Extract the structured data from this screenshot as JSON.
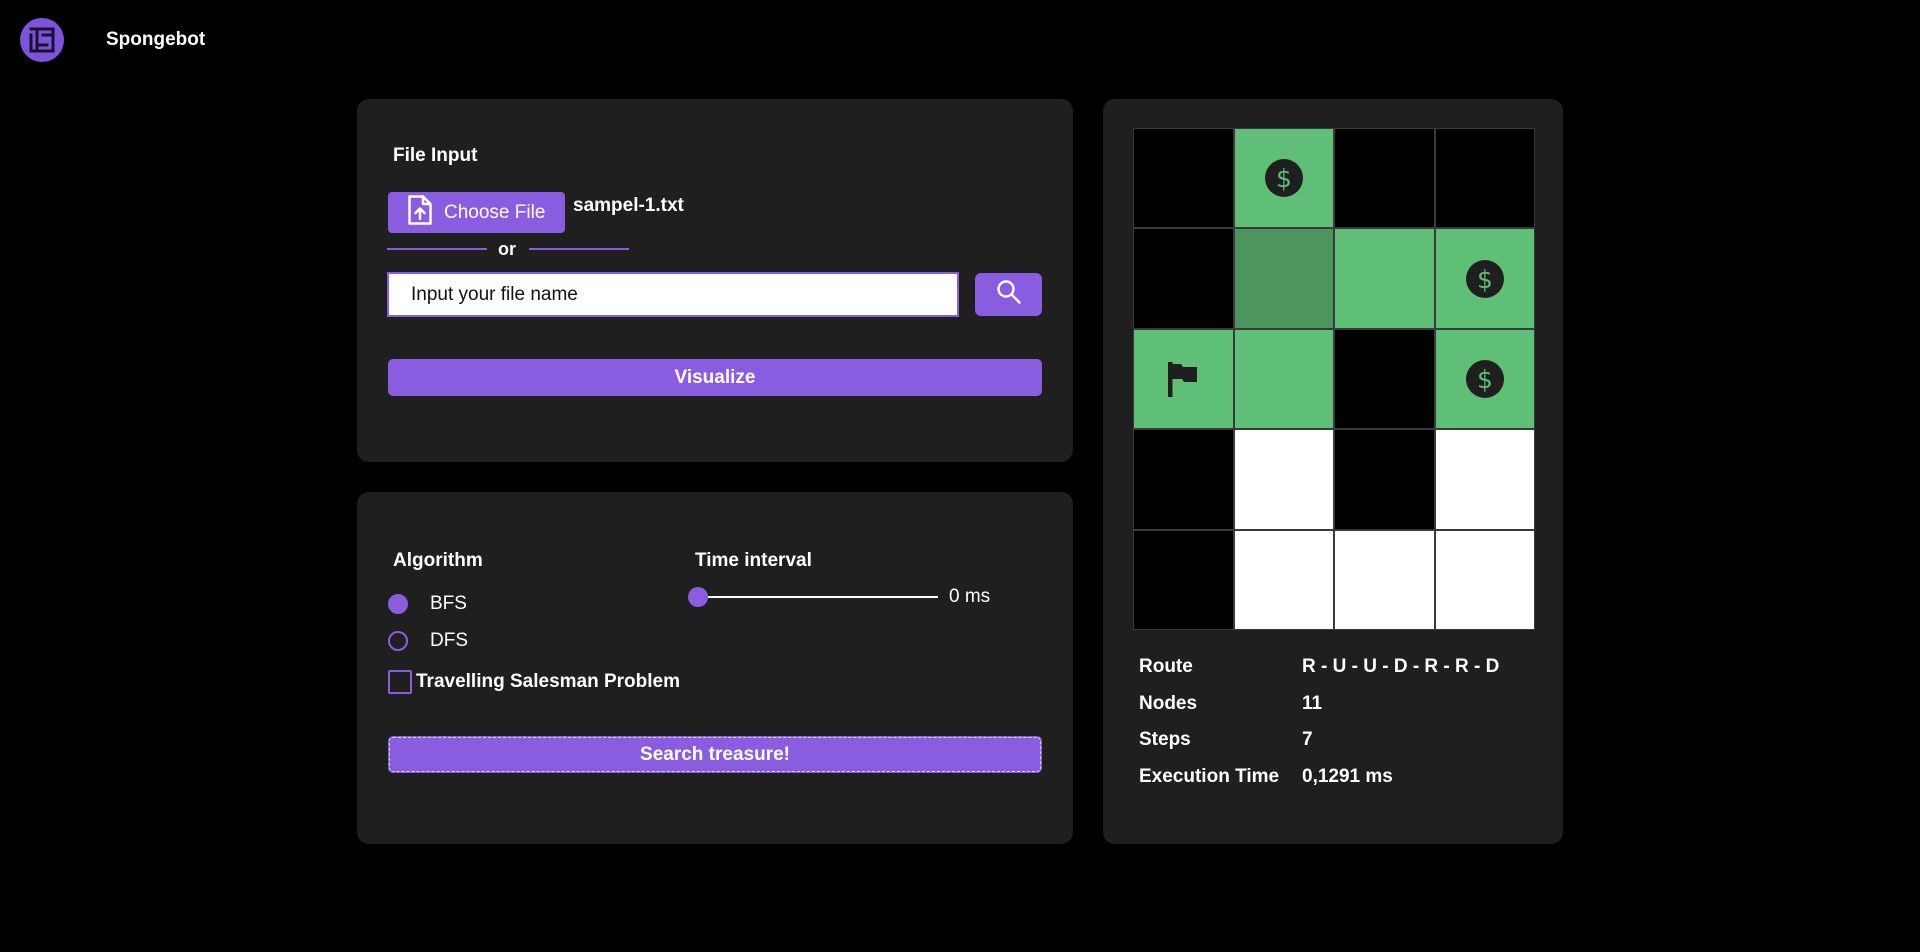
{
  "app": {
    "name": "Spongebot"
  },
  "file_panel": {
    "title": "File Input",
    "choose_file_label": "Choose File",
    "selected_file": "sampel-1.txt",
    "or_label": "or",
    "file_name_placeholder": "Input your file name",
    "visualize_label": "Visualize"
  },
  "search_panel": {
    "algorithm_title": "Algorithm",
    "algorithms": [
      {
        "label": "BFS",
        "selected": true
      },
      {
        "label": "DFS",
        "selected": false
      }
    ],
    "time_interval_title": "Time interval",
    "time_interval_value": 0,
    "time_interval_display": "0 ms",
    "tsp_label": "Travelling Salesman Problem",
    "tsp_checked": false,
    "search_label": "Search treasure!"
  },
  "maze": {
    "rows": 5,
    "cols": 4,
    "cells": [
      [
        "wall",
        "treasure-path",
        "wall",
        "wall"
      ],
      [
        "wall",
        "path-revisited",
        "path",
        "treasure-path"
      ],
      [
        "start-path",
        "path",
        "wall",
        "treasure-path"
      ],
      [
        "wall",
        "empty",
        "wall",
        "empty"
      ],
      [
        "wall",
        "empty",
        "empty",
        "empty"
      ]
    ],
    "colors": {
      "wall": "#000000",
      "empty": "#ffffff",
      "path": "#5fbf76",
      "path_revisited": "#4e945e",
      "icon_dark": "#1f1f1f",
      "accent": "#8a5ce0"
    }
  },
  "results": {
    "route_label": "Route",
    "route_value": "R - U - U - D - R - R - D",
    "nodes_label": "Nodes",
    "nodes_value": "11",
    "steps_label": "Steps",
    "steps_value": "7",
    "time_label": "Execution Time",
    "time_value": "0,1291 ms"
  }
}
